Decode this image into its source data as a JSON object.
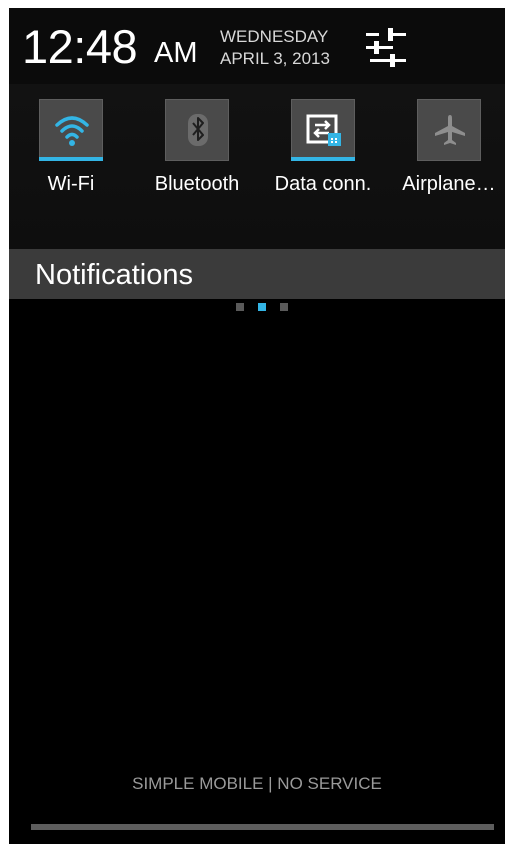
{
  "status": {
    "time": "12:48",
    "ampm": "AM",
    "day": "WEDNESDAY",
    "date": "APRIL 3, 2013",
    "settings_icon": "settings-sliders-icon"
  },
  "quick_settings": {
    "tiles": [
      {
        "label": "Wi-Fi",
        "icon": "wifi-icon",
        "active": true
      },
      {
        "label": "Bluetooth",
        "icon": "bluetooth-icon",
        "active": false
      },
      {
        "label": "Data conn.",
        "icon": "data-connection-icon",
        "active": true
      },
      {
        "label": "Airplane…",
        "icon": "airplane-icon",
        "active": false
      }
    ],
    "page_indicator": {
      "pages": 3,
      "current": 2
    }
  },
  "notifications": {
    "title": "Notifications"
  },
  "footer": {
    "carrier_text": "SIMPLE MOBILE | NO SERVICE"
  },
  "colors": {
    "accent": "#33b5e5",
    "background": "#000000",
    "header_bar": "#3b3b3b",
    "tile_bg": "#4a4a4a",
    "inactive_icon": "#8e8e8e"
  }
}
